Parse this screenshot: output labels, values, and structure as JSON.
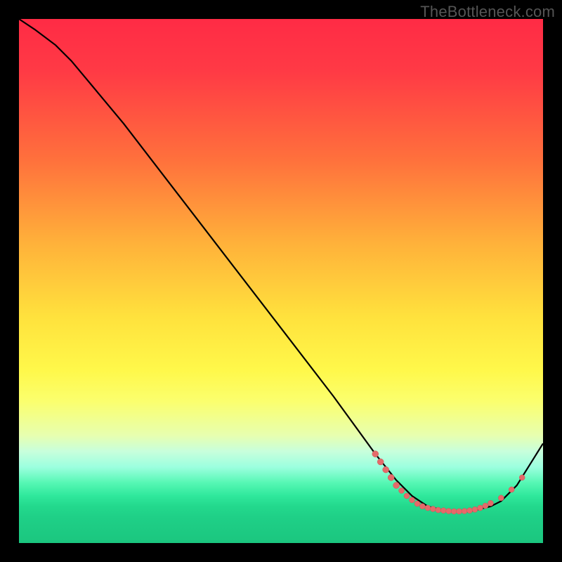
{
  "watermark": "TheBottleneck.com",
  "chart_data": {
    "type": "line",
    "title": "",
    "xlabel": "",
    "ylabel": "",
    "xlim": [
      0,
      100
    ],
    "ylim": [
      0,
      100
    ],
    "grid": false,
    "series": [
      {
        "name": "curve",
        "x": [
          0,
          3,
          7,
          10,
          15,
          20,
          30,
          40,
          50,
          60,
          68,
          72,
          75,
          78,
          82,
          86,
          90,
          92,
          95,
          100
        ],
        "y": [
          100,
          98,
          95,
          92,
          86,
          80,
          67,
          54,
          41,
          28,
          17,
          12,
          9,
          7,
          6,
          6,
          7,
          8,
          11,
          19
        ]
      }
    ],
    "scatter": {
      "name": "highlight-points",
      "color": "#e46a6a",
      "points": [
        {
          "x": 68,
          "y": 17,
          "r": 4.5
        },
        {
          "x": 69,
          "y": 15.5,
          "r": 4.5
        },
        {
          "x": 70,
          "y": 14,
          "r": 4.5
        },
        {
          "x": 71,
          "y": 12.5,
          "r": 4.5
        },
        {
          "x": 72,
          "y": 11,
          "r": 4.5
        },
        {
          "x": 73,
          "y": 10,
          "r": 4
        },
        {
          "x": 74,
          "y": 9,
          "r": 4
        },
        {
          "x": 75,
          "y": 8.2,
          "r": 4
        },
        {
          "x": 76,
          "y": 7.5,
          "r": 4
        },
        {
          "x": 77,
          "y": 7,
          "r": 4
        },
        {
          "x": 78,
          "y": 6.7,
          "r": 4
        },
        {
          "x": 79,
          "y": 6.5,
          "r": 4
        },
        {
          "x": 80,
          "y": 6.3,
          "r": 4
        },
        {
          "x": 81,
          "y": 6.2,
          "r": 4
        },
        {
          "x": 82,
          "y": 6.1,
          "r": 4
        },
        {
          "x": 83,
          "y": 6.05,
          "r": 4
        },
        {
          "x": 84,
          "y": 6.05,
          "r": 4
        },
        {
          "x": 85,
          "y": 6.1,
          "r": 4
        },
        {
          "x": 86,
          "y": 6.2,
          "r": 4
        },
        {
          "x": 87,
          "y": 6.4,
          "r": 4
        },
        {
          "x": 88,
          "y": 6.7,
          "r": 4
        },
        {
          "x": 89,
          "y": 7.1,
          "r": 4
        },
        {
          "x": 90,
          "y": 7.6,
          "r": 4
        },
        {
          "x": 92,
          "y": 8.6,
          "r": 4
        },
        {
          "x": 94,
          "y": 10.2,
          "r": 4
        },
        {
          "x": 96,
          "y": 12.5,
          "r": 4
        }
      ]
    },
    "background": "vertical-gradient-red-to-green"
  }
}
